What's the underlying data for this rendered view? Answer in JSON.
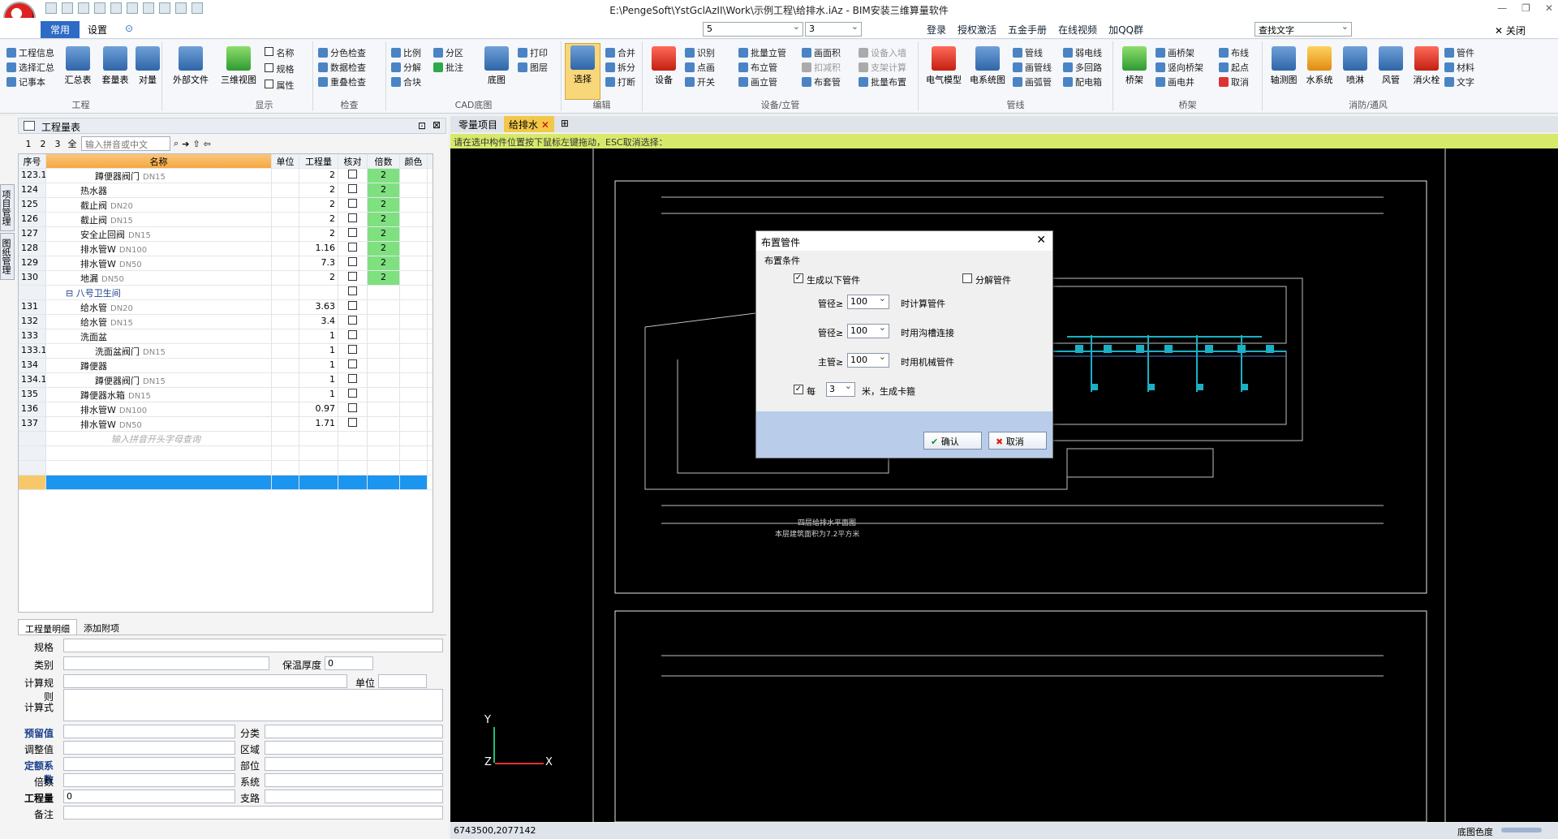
{
  "window": {
    "title": "E:\\PengeSoft\\YstGclAzII\\Work\\示例工程\\给排水.iAz - BIM安装三维算量软件",
    "close": "关闭"
  },
  "tabs": [
    {
      "label": "常用"
    },
    {
      "label": "设置"
    }
  ],
  "combos": {
    "left": "5",
    "right": "3",
    "find": "查找文字"
  },
  "toptools": [
    "登录",
    "授权激活",
    "五金手册",
    "在线视频",
    "加QQ群"
  ],
  "ribbon": {
    "groups": [
      "工程",
      "显示",
      "检查",
      "CAD底图",
      "编辑",
      "设备/立管",
      "管线",
      "桥架",
      "消防/通风"
    ],
    "gongcheng": [
      "工程信息",
      "选择汇总",
      "记事本",
      "汇总表",
      "套量表",
      "对量",
      "外部文件"
    ],
    "xianshi": [
      "三维视图",
      "名称",
      "规格",
      "属性"
    ],
    "jiancha": [
      "分色检查",
      "数据检查",
      "重叠检查"
    ],
    "cad": [
      "比例",
      "分解",
      "合块",
      "分区",
      "批注",
      "底图",
      "打印",
      "图层"
    ],
    "edit": [
      "选择",
      "合并",
      "拆分",
      "打断"
    ],
    "shebei": [
      "设备",
      "识别",
      "点画",
      "开关",
      "批量立管",
      "布立管",
      "画立管",
      "画面积",
      "扣减积",
      "布套管",
      "设备入墙",
      "支架计算",
      "批量布置"
    ],
    "guanxian": [
      "电气模型",
      "电系统图",
      "管线",
      "画管线",
      "画弧管",
      "弱电线",
      "多回路",
      "配电箱"
    ],
    "qiaojia": [
      "桥架",
      "画桥架",
      "竖向桥架",
      "画电井",
      "布线",
      "起点",
      "取消"
    ],
    "xiaofang": [
      "轴测图",
      "水系统",
      "喷淋",
      "风管",
      "消火栓",
      "管件",
      "材料",
      "文字"
    ]
  },
  "leftpanel": {
    "vtabs": [
      "项目管理",
      "图纸管理"
    ],
    "title": "工程量表",
    "levels": [
      "1",
      "2",
      "3",
      "全"
    ],
    "search_placeholder": "输入拼音或中文",
    "columns": [
      "序号",
      "名称",
      "单位",
      "工程量",
      "核对",
      "倍数",
      "颜色"
    ],
    "rows": [
      {
        "no": "123.1",
        "name": "蹲便器阀门",
        "spec": "DN15",
        "qty": "2",
        "mult": "2",
        "indent": 3
      },
      {
        "no": "124",
        "name": "热水器",
        "spec": "",
        "qty": "2",
        "mult": "2",
        "indent": 2
      },
      {
        "no": "125",
        "name": "截止阀",
        "spec": "DN20",
        "qty": "2",
        "mult": "2",
        "indent": 2
      },
      {
        "no": "126",
        "name": "截止阀",
        "spec": "DN15",
        "qty": "2",
        "mult": "2",
        "indent": 2
      },
      {
        "no": "127",
        "name": "安全止回阀",
        "spec": "DN15",
        "qty": "2",
        "mult": "2",
        "indent": 2
      },
      {
        "no": "128",
        "name": "排水管W",
        "spec": "DN100",
        "qty": "1.16",
        "mult": "2",
        "indent": 2
      },
      {
        "no": "129",
        "name": "排水管W",
        "spec": "DN50",
        "qty": "7.3",
        "mult": "2",
        "indent": 2
      },
      {
        "no": "130",
        "name": "地漏",
        "spec": "DN50",
        "qty": "2",
        "mult": "2",
        "indent": 2
      },
      {
        "no": "",
        "name": "八号卫生间",
        "spec": "",
        "qty": "",
        "mult": "",
        "indent": 1
      },
      {
        "no": "131",
        "name": "给水管",
        "spec": "DN20",
        "qty": "3.63",
        "mult": "",
        "indent": 2
      },
      {
        "no": "132",
        "name": "给水管",
        "spec": "DN15",
        "qty": "3.4",
        "mult": "",
        "indent": 2
      },
      {
        "no": "133",
        "name": "洗面盆",
        "spec": "",
        "qty": "1",
        "mult": "",
        "indent": 2
      },
      {
        "no": "133.1",
        "name": "洗面盆阀门",
        "spec": "DN15",
        "qty": "1",
        "mult": "",
        "indent": 3
      },
      {
        "no": "134",
        "name": "蹲便器",
        "spec": "",
        "qty": "1",
        "mult": "",
        "indent": 2
      },
      {
        "no": "134.1",
        "name": "蹲便器阀门",
        "spec": "DN15",
        "qty": "1",
        "mult": "",
        "indent": 3
      },
      {
        "no": "135",
        "name": "蹲便器水箱",
        "spec": "DN15",
        "qty": "1",
        "mult": "",
        "indent": 2
      },
      {
        "no": "136",
        "name": "排水管W",
        "spec": "DN100",
        "qty": "0.97",
        "mult": "",
        "indent": 2
      },
      {
        "no": "137",
        "name": "排水管W",
        "spec": "DN50",
        "qty": "1.71",
        "mult": "",
        "indent": 2
      }
    ],
    "hint": "输入拼音开头字母查询"
  },
  "detail": {
    "tabs": [
      "工程量明细",
      "添加附项"
    ],
    "labels": [
      "规格",
      "类别",
      "计算规则",
      "计算式",
      "预留值",
      "调整值",
      "定额系数",
      "倍数",
      "工程量",
      "备注"
    ],
    "right_labels": [
      "保温厚度",
      "单位",
      "分类",
      "区域",
      "部位",
      "系统",
      "支路"
    ],
    "insul": "0",
    "qty_value": "0"
  },
  "doctabs": [
    "零量项目",
    "给排水"
  ],
  "prompt": "请在选中构件位置按下鼠标左键拖动，ESC取消选择：",
  "statusbar": {
    "coords": "6743500,2077142",
    "right": "底图色度"
  },
  "dialog": {
    "title": "布置管件",
    "section": "布置条件",
    "gen_label": "生成以下管件",
    "split_label": "分解管件",
    "row1_label": "管径≥",
    "row1_val": "100",
    "row1_suffix": "时计算管件",
    "row2_label": "管径≥",
    "row2_val": "100",
    "row2_suffix": "时用沟槽连接",
    "row3_label": "主管≥",
    "row3_val": "100",
    "row3_suffix": "时用机械管件",
    "every_label": "每",
    "every_val": "3",
    "every_suffix": "米，生成卡箍",
    "ok": "确认",
    "cancel": "取消"
  },
  "cad_texts": {
    "title1": "四层给排水平面图",
    "title2": "本层建筑面积为7.2平方米",
    "axis_y": "Y",
    "axis_x": "X",
    "axis_z": "Z"
  }
}
